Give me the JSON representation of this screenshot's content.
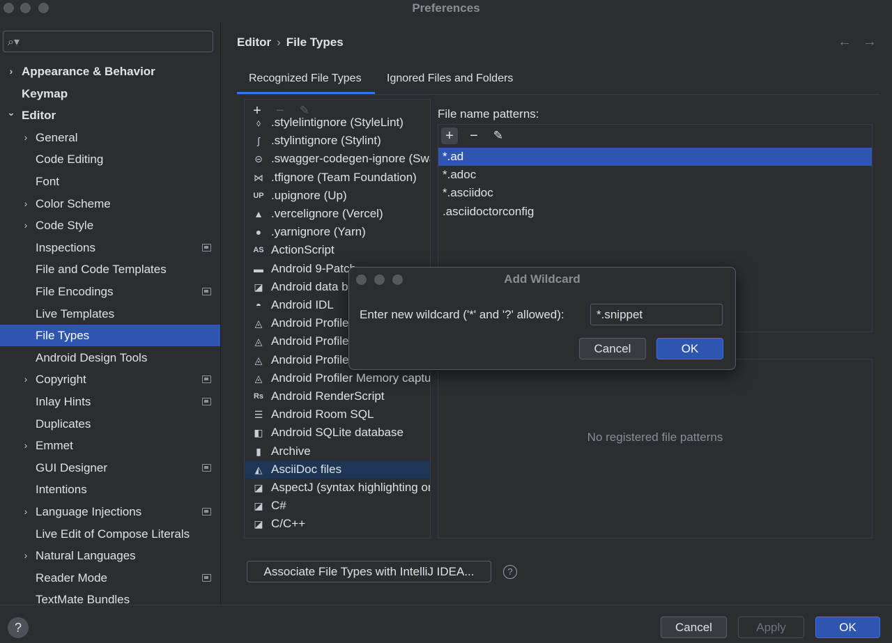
{
  "window": {
    "title": "Preferences"
  },
  "sidebar": {
    "search_placeholder": "",
    "items": [
      {
        "label": "Appearance & Behavior",
        "level": 0,
        "chevron": "right",
        "bold": true
      },
      {
        "label": "Keymap",
        "level": 0,
        "chevron": "",
        "bold": true
      },
      {
        "label": "Editor",
        "level": 0,
        "chevron": "down",
        "bold": true
      },
      {
        "label": "General",
        "level": 1,
        "chevron": "right"
      },
      {
        "label": "Code Editing",
        "level": 1,
        "chevron": ""
      },
      {
        "label": "Font",
        "level": 1,
        "chevron": ""
      },
      {
        "label": "Color Scheme",
        "level": 1,
        "chevron": "right"
      },
      {
        "label": "Code Style",
        "level": 1,
        "chevron": "right"
      },
      {
        "label": "Inspections",
        "level": 1,
        "chevron": "",
        "project": true
      },
      {
        "label": "File and Code Templates",
        "level": 1,
        "chevron": ""
      },
      {
        "label": "File Encodings",
        "level": 1,
        "chevron": "",
        "project": true
      },
      {
        "label": "Live Templates",
        "level": 1,
        "chevron": ""
      },
      {
        "label": "File Types",
        "level": 1,
        "chevron": "",
        "selected": true
      },
      {
        "label": "Android Design Tools",
        "level": 1,
        "chevron": ""
      },
      {
        "label": "Copyright",
        "level": 1,
        "chevron": "right",
        "project": true
      },
      {
        "label": "Inlay Hints",
        "level": 1,
        "chevron": "",
        "project": true
      },
      {
        "label": "Duplicates",
        "level": 1,
        "chevron": ""
      },
      {
        "label": "Emmet",
        "level": 1,
        "chevron": "right"
      },
      {
        "label": "GUI Designer",
        "level": 1,
        "chevron": "",
        "project": true
      },
      {
        "label": "Intentions",
        "level": 1,
        "chevron": ""
      },
      {
        "label": "Language Injections",
        "level": 1,
        "chevron": "right",
        "project": true
      },
      {
        "label": "Live Edit of Compose Literals",
        "level": 1,
        "chevron": ""
      },
      {
        "label": "Natural Languages",
        "level": 1,
        "chevron": "right"
      },
      {
        "label": "Reader Mode",
        "level": 1,
        "chevron": "",
        "project": true
      },
      {
        "label": "TextMate Bundles",
        "level": 1,
        "chevron": ""
      }
    ]
  },
  "breadcrumb": {
    "parent": "Editor",
    "separator": "›",
    "current": "File Types"
  },
  "nav": {
    "back": "←",
    "forward": "→"
  },
  "tabs": [
    {
      "label": "Recognized File Types",
      "active": true
    },
    {
      "label": "Ignored Files and Folders",
      "active": false
    }
  ],
  "file_types": {
    "toolbar": {
      "add": "+",
      "remove": "−",
      "edit": "✎"
    },
    "items": [
      {
        "label": ".stylelintignore (StyleLint)",
        "icon": "stylelint-icon",
        "glyph": "⬨"
      },
      {
        "label": ".stylintignore (Stylint)",
        "icon": "stylint-icon",
        "glyph": "ʃ"
      },
      {
        "label": ".swagger-codegen-ignore (Swagger)",
        "icon": "swagger-icon",
        "glyph": "⊝"
      },
      {
        "label": ".tfignore (Team Foundation)",
        "icon": "tfs-icon",
        "glyph": "⋈"
      },
      {
        "label": ".upignore (Up)",
        "icon": "up-icon",
        "glyph": "UP"
      },
      {
        "label": ".vercelignore (Vercel)",
        "icon": "vercel-icon",
        "glyph": "▲"
      },
      {
        "label": ".yarnignore (Yarn)",
        "icon": "yarn-icon",
        "glyph": "●"
      },
      {
        "label": "ActionScript",
        "icon": "actionscript-icon",
        "glyph": "AS"
      },
      {
        "label": "Android 9-Patch",
        "icon": "folder-icon",
        "glyph": "▬"
      },
      {
        "label": "Android data binding",
        "icon": "android-data-icon",
        "glyph": "◪"
      },
      {
        "label": "Android IDL",
        "icon": "android-icon",
        "glyph": "◓"
      },
      {
        "label": "Android Profiler",
        "icon": "profiler-icon",
        "glyph": "◬"
      },
      {
        "label": "Android Profiler",
        "icon": "profiler-icon",
        "glyph": "◬"
      },
      {
        "label": "Android Profiler",
        "icon": "profiler-icon",
        "glyph": "◬"
      },
      {
        "label": "Android Profiler Memory capture",
        "icon": "profiler-icon",
        "glyph": "◬"
      },
      {
        "label": "Android RenderScript",
        "icon": "renderscript-icon",
        "glyph": "Rs"
      },
      {
        "label": "Android Room SQL",
        "icon": "database-icon",
        "glyph": "☰"
      },
      {
        "label": "Android SQLite database",
        "icon": "sqlite-icon",
        "glyph": "◧"
      },
      {
        "label": "Archive",
        "icon": "archive-icon",
        "glyph": "▮"
      },
      {
        "label": "AsciiDoc files",
        "icon": "asciidoc-icon",
        "glyph": "◭",
        "selected": true
      },
      {
        "label": "AspectJ (syntax highlighting only)",
        "icon": "aspectj-icon",
        "glyph": "◪"
      },
      {
        "label": "C#",
        "icon": "csharp-icon",
        "glyph": "◪"
      },
      {
        "label": "C/C++",
        "icon": "cpp-icon",
        "glyph": "◪"
      }
    ]
  },
  "patterns": {
    "label": "File name patterns:",
    "toolbar": {
      "add": "+",
      "remove": "−",
      "edit": "✎"
    },
    "items": [
      {
        "label": "*.ad",
        "selected": true
      },
      {
        "label": "*.adoc"
      },
      {
        "label": "*.asciidoc"
      },
      {
        "label": ".asciidoctorconfig"
      }
    ]
  },
  "hashbang": {
    "empty_text": "No registered file patterns"
  },
  "associate_button": "Associate File Types with IntelliJ IDEA...",
  "help_glyph": "?",
  "footer": {
    "help": "?",
    "cancel": "Cancel",
    "apply": "Apply",
    "ok": "OK"
  },
  "dialog": {
    "title": "Add Wildcard",
    "label": "Enter new wildcard ('*' and '?' allowed):",
    "value": "*.snippet",
    "cancel": "Cancel",
    "ok": "OK"
  },
  "colors": {
    "accent": "#3574f0",
    "selection": "#2e55b0",
    "background": "#2b2d30"
  }
}
